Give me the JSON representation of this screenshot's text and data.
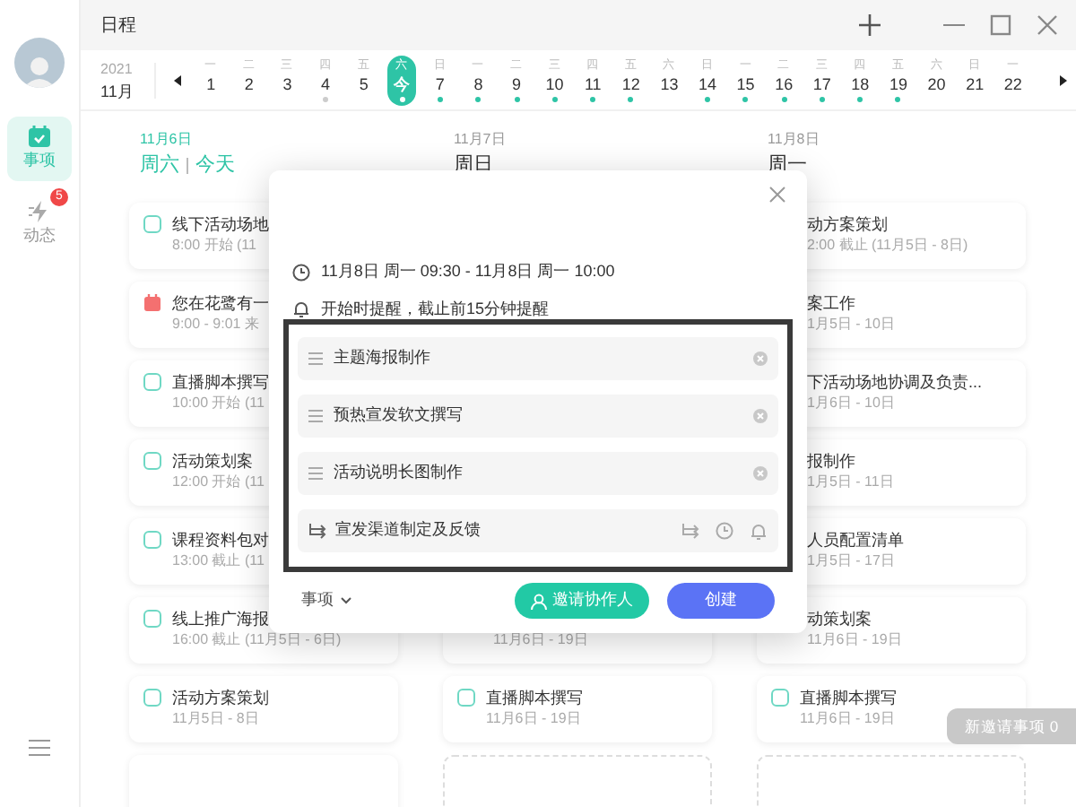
{
  "window": {
    "title": "日程"
  },
  "sidebar": {
    "items": [
      {
        "label": "事项",
        "selected": true,
        "kind": "calendar"
      },
      {
        "label": "动态",
        "selected": false,
        "kind": "activity",
        "badge": "5"
      }
    ]
  },
  "date_strip": {
    "year": "2021",
    "month": "11月",
    "days": [
      {
        "weekday": "一",
        "date": "1",
        "selected": false
      },
      {
        "weekday": "二",
        "date": "2",
        "selected": false
      },
      {
        "weekday": "三",
        "date": "3",
        "selected": false
      },
      {
        "weekday": "四",
        "date": "4",
        "selected": false,
        "color": "#cccccc"
      },
      {
        "weekday": "五",
        "date": "5",
        "selected": false
      },
      {
        "weekday": "六",
        "date": "今",
        "selected": true,
        "color": "#ffffff"
      },
      {
        "weekday": "日",
        "date": "7",
        "selected": false,
        "color": "#2ec4a6"
      },
      {
        "weekday": "一",
        "date": "8",
        "selected": false,
        "color": "#2ec4a6"
      },
      {
        "weekday": "二",
        "date": "9",
        "selected": false,
        "color": "#2ec4a6"
      },
      {
        "weekday": "三",
        "date": "10",
        "selected": false,
        "color": "#2ec4a6"
      },
      {
        "weekday": "四",
        "date": "11",
        "selected": false,
        "color": "#2ec4a6"
      },
      {
        "weekday": "五",
        "date": "12",
        "selected": false,
        "color": "#2ec4a6"
      },
      {
        "weekday": "六",
        "date": "13",
        "selected": false
      },
      {
        "weekday": "日",
        "date": "14",
        "selected": false,
        "color": "#2ec4a6"
      },
      {
        "weekday": "一",
        "date": "15",
        "selected": false,
        "color": "#2ec4a6"
      },
      {
        "weekday": "二",
        "date": "16",
        "selected": false,
        "color": "#2ec4a6"
      },
      {
        "weekday": "三",
        "date": "17",
        "selected": false,
        "color": "#2ec4a6"
      },
      {
        "weekday": "四",
        "date": "18",
        "selected": false,
        "color": "#2ec4a6"
      },
      {
        "weekday": "五",
        "date": "19",
        "selected": false,
        "color": "#2ec4a6"
      },
      {
        "weekday": "六",
        "date": "20",
        "selected": false
      },
      {
        "weekday": "日",
        "date": "21",
        "selected": false
      },
      {
        "weekday": "一",
        "date": "22",
        "selected": false
      }
    ]
  },
  "columns": [
    {
      "date": "11月6日",
      "weekday": "周六",
      "today": "今天",
      "cards": [
        {
          "kind": "task",
          "checked": false,
          "title": "线下活动场地",
          "subtitle": "8:00 开始 (11"
        },
        {
          "kind": "event",
          "title": "您在花鹭有一",
          "subtitle": "9:00 - 9:01 来"
        },
        {
          "kind": "task",
          "checked": false,
          "title": "直播脚本撰写",
          "subtitle": "10:00 开始 (11"
        },
        {
          "kind": "task",
          "checked": false,
          "title": "活动策划案",
          "subtitle": "12:00 开始 (11"
        },
        {
          "kind": "task",
          "checked": false,
          "title": "课程资料包对",
          "subtitle": "13:00 截止 (11"
        },
        {
          "kind": "task",
          "checked": false,
          "title": "线上推广海报",
          "subtitle": "16:00 截止 (11月5日 - 6日)"
        },
        {
          "kind": "task",
          "checked": false,
          "title": "活动方案策划",
          "subtitle": "11月5日 - 8日"
        },
        {
          "kind": "blank"
        }
      ]
    },
    {
      "date": "11月7日",
      "weekday": "周日",
      "cards": [
        {
          "kind": "covered",
          "subtitle": "11月6日 - 19日"
        },
        {
          "kind": "task",
          "checked": false,
          "title": "直播脚本撰写",
          "subtitle": "11月6日 - 19日"
        },
        {
          "kind": "placeholder"
        }
      ]
    },
    {
      "date": "11月8日",
      "weekday": "周一",
      "cards": [
        {
          "kind": "covered",
          "title": "动方案策划",
          "subtitle": "2:00 截止 (11月5日 - 8日)"
        },
        {
          "kind": "covered",
          "title": "案工作",
          "subtitle": "1月5日 - 10日"
        },
        {
          "kind": "covered",
          "title": "下活动场地协调及负责...",
          "subtitle": "1月6日 - 10日"
        },
        {
          "kind": "covered",
          "title": "报制作",
          "subtitle": "1月5日 - 11日"
        },
        {
          "kind": "covered",
          "title": "人员配置清单",
          "subtitle": "1月5日 - 17日"
        },
        {
          "kind": "covered",
          "title": "动策划案",
          "subtitle": "11月6日 - 19日"
        },
        {
          "kind": "task",
          "checked": false,
          "title": "直播脚本撰写",
          "subtitle": "11月6日 - 19日"
        },
        {
          "kind": "placeholder"
        }
      ]
    }
  ],
  "invite_badge": "新邀请事项 0",
  "dialog": {
    "time": "11月8日 周一 09:30 - 11月8日 周一 10:00",
    "reminder": "开始时提醒，截止前15分钟提醒",
    "subtasks": [
      "主题海报制作",
      "预热宣发软文撰写",
      "活动说明长图制作"
    ],
    "new_subtask": "宣发渠道制定及反馈",
    "type": "事项",
    "invite_button": "邀请协作人",
    "create_button": "创建"
  }
}
